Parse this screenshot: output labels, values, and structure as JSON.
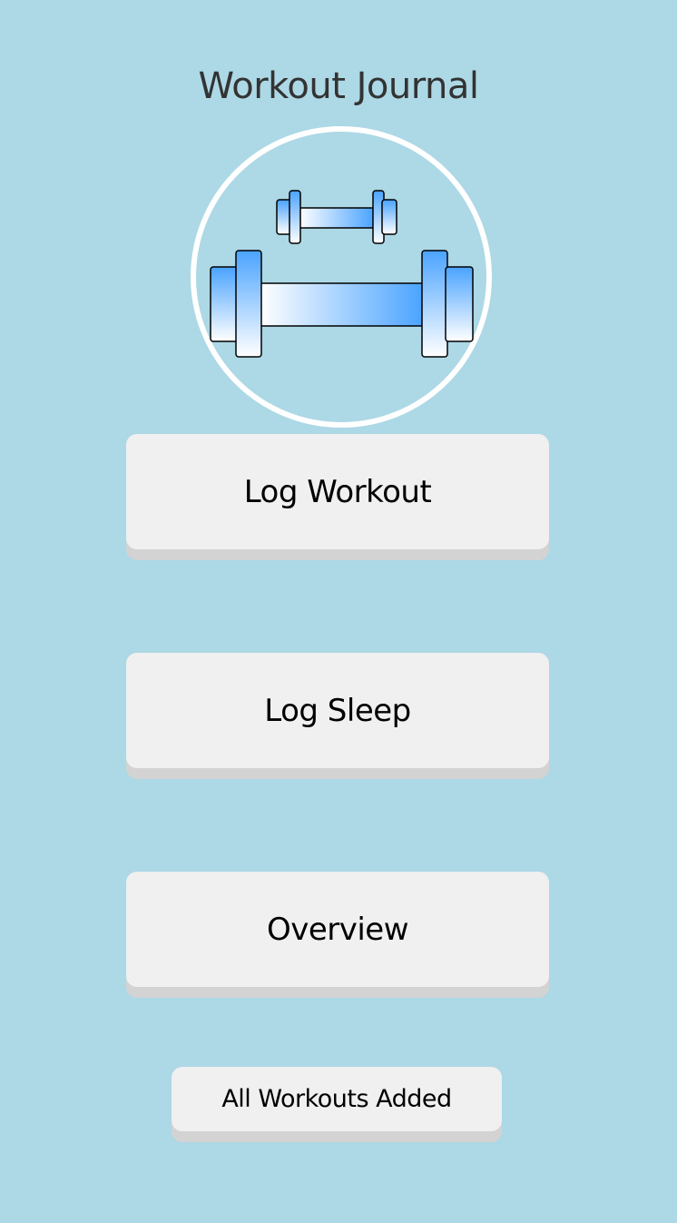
{
  "app": {
    "title": "Workout Journal"
  },
  "logo": {
    "icon": "dumbbell-icon",
    "ring_color": "#ffffff",
    "gradient_start": "#ffffff",
    "gradient_end": "#4aa3ff"
  },
  "menu": {
    "log_workout_label": "Log Workout",
    "log_sleep_label": "Log Sleep",
    "overview_label": "Overview",
    "all_workouts_label": "All Workouts Added"
  },
  "theme": {
    "background": "#add8e6",
    "button_face": "#f0f0f0",
    "button_shadow": "#d3d3d3",
    "title_color": "#333333"
  }
}
